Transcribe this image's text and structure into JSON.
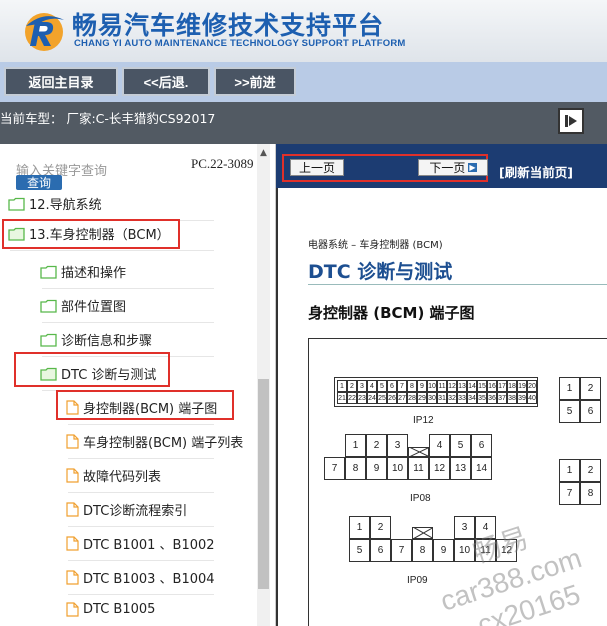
{
  "header": {
    "brand_cn": "畅易汽车维修技术支持平台",
    "brand_en": "CHANG YI AUTO MAINTENANCE TECHNOLOGY SUPPORT PLATFORM"
  },
  "nav": {
    "home": "返回主目录",
    "back": "<<后退.",
    "forward": ">>前进"
  },
  "vehicle": {
    "text": "当前车型： 厂家:C-长丰猎豹CS92017"
  },
  "search": {
    "placeholder": "输入关键字查询",
    "button": "查询",
    "pc": "PC.22-3089"
  },
  "tree": {
    "items": [
      {
        "label": "12.导航系统",
        "type": "folder"
      },
      {
        "label": "13.车身控制器（BCM）",
        "type": "folder-open"
      },
      {
        "label": "描述和操作",
        "type": "folder"
      },
      {
        "label": "部件位置图",
        "type": "folder"
      },
      {
        "label": "诊断信息和步骤",
        "type": "folder"
      },
      {
        "label": "DTC 诊断与测试",
        "type": "folder-open"
      },
      {
        "label": "身控制器(BCM) 端子图",
        "type": "doc"
      },
      {
        "label": "车身控制器(BCM) 端子列表",
        "type": "doc"
      },
      {
        "label": "故障代码列表",
        "type": "doc"
      },
      {
        "label": "DTC诊断流程索引",
        "type": "doc"
      },
      {
        "label": "DTC B1001 、B1002",
        "type": "doc"
      },
      {
        "label": "DTC B1003 、B1004",
        "type": "doc"
      },
      {
        "label": "DTC B1005",
        "type": "doc"
      }
    ]
  },
  "doc_toolbar": {
    "prev": "上一页",
    "next": "下一页",
    "refresh": "[刷新当前页]"
  },
  "doc": {
    "section": "电器系统 – 车身控制器 (BCM)",
    "title": "DTC 诊断与测试",
    "subtitle": "身控制器 (BCM) 端子图",
    "connectors": {
      "ip12": "IP12",
      "ip08": "IP08",
      "ip09": "IP09",
      "ip08_top": [
        "1",
        "2",
        "3",
        "4",
        "5",
        "6"
      ],
      "ip08_bottom": [
        "7",
        "8",
        "9",
        "10",
        "11",
        "12",
        "13",
        "14"
      ],
      "ip09_top": [
        "1",
        "2",
        "3",
        "4"
      ],
      "ip09_bottom": [
        "5",
        "6",
        "7",
        "8",
        "9",
        "10",
        "11",
        "12"
      ],
      "r1": [
        "1",
        "2",
        "5",
        "6"
      ],
      "r2": [
        "1",
        "2",
        "7",
        "8"
      ]
    }
  },
  "watermark": {
    "w1": "畅易",
    "w2": "car388.com",
    "w3": "cx20165"
  },
  "colors": {
    "brand": "#1d5fb0",
    "nav_bg": "#b9cbe6",
    "vehicle_bar": "#525a63",
    "doc_toolbar": "#1c3c72",
    "highlight": "#e0302a",
    "doc_title": "#1d4f91"
  }
}
